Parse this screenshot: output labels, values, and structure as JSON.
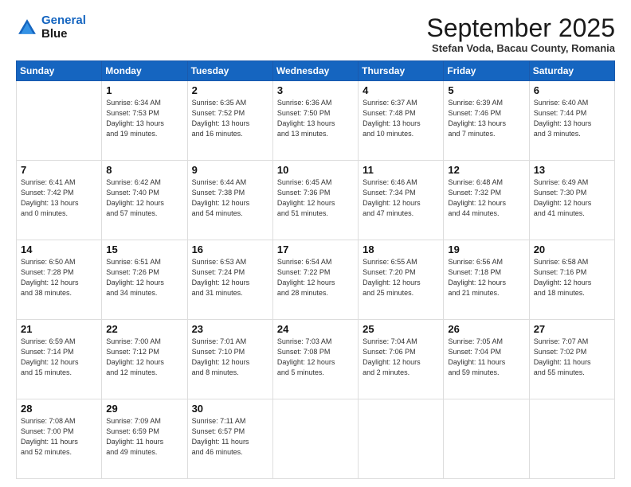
{
  "header": {
    "logo_line1": "General",
    "logo_line2": "Blue",
    "month_title": "September 2025",
    "subtitle": "Stefan Voda, Bacau County, Romania"
  },
  "weekdays": [
    "Sunday",
    "Monday",
    "Tuesday",
    "Wednesday",
    "Thursday",
    "Friday",
    "Saturday"
  ],
  "weeks": [
    [
      {
        "day": "",
        "info": ""
      },
      {
        "day": "1",
        "info": "Sunrise: 6:34 AM\nSunset: 7:53 PM\nDaylight: 13 hours\nand 19 minutes."
      },
      {
        "day": "2",
        "info": "Sunrise: 6:35 AM\nSunset: 7:52 PM\nDaylight: 13 hours\nand 16 minutes."
      },
      {
        "day": "3",
        "info": "Sunrise: 6:36 AM\nSunset: 7:50 PM\nDaylight: 13 hours\nand 13 minutes."
      },
      {
        "day": "4",
        "info": "Sunrise: 6:37 AM\nSunset: 7:48 PM\nDaylight: 13 hours\nand 10 minutes."
      },
      {
        "day": "5",
        "info": "Sunrise: 6:39 AM\nSunset: 7:46 PM\nDaylight: 13 hours\nand 7 minutes."
      },
      {
        "day": "6",
        "info": "Sunrise: 6:40 AM\nSunset: 7:44 PM\nDaylight: 13 hours\nand 3 minutes."
      }
    ],
    [
      {
        "day": "7",
        "info": "Sunrise: 6:41 AM\nSunset: 7:42 PM\nDaylight: 13 hours\nand 0 minutes."
      },
      {
        "day": "8",
        "info": "Sunrise: 6:42 AM\nSunset: 7:40 PM\nDaylight: 12 hours\nand 57 minutes."
      },
      {
        "day": "9",
        "info": "Sunrise: 6:44 AM\nSunset: 7:38 PM\nDaylight: 12 hours\nand 54 minutes."
      },
      {
        "day": "10",
        "info": "Sunrise: 6:45 AM\nSunset: 7:36 PM\nDaylight: 12 hours\nand 51 minutes."
      },
      {
        "day": "11",
        "info": "Sunrise: 6:46 AM\nSunset: 7:34 PM\nDaylight: 12 hours\nand 47 minutes."
      },
      {
        "day": "12",
        "info": "Sunrise: 6:48 AM\nSunset: 7:32 PM\nDaylight: 12 hours\nand 44 minutes."
      },
      {
        "day": "13",
        "info": "Sunrise: 6:49 AM\nSunset: 7:30 PM\nDaylight: 12 hours\nand 41 minutes."
      }
    ],
    [
      {
        "day": "14",
        "info": "Sunrise: 6:50 AM\nSunset: 7:28 PM\nDaylight: 12 hours\nand 38 minutes."
      },
      {
        "day": "15",
        "info": "Sunrise: 6:51 AM\nSunset: 7:26 PM\nDaylight: 12 hours\nand 34 minutes."
      },
      {
        "day": "16",
        "info": "Sunrise: 6:53 AM\nSunset: 7:24 PM\nDaylight: 12 hours\nand 31 minutes."
      },
      {
        "day": "17",
        "info": "Sunrise: 6:54 AM\nSunset: 7:22 PM\nDaylight: 12 hours\nand 28 minutes."
      },
      {
        "day": "18",
        "info": "Sunrise: 6:55 AM\nSunset: 7:20 PM\nDaylight: 12 hours\nand 25 minutes."
      },
      {
        "day": "19",
        "info": "Sunrise: 6:56 AM\nSunset: 7:18 PM\nDaylight: 12 hours\nand 21 minutes."
      },
      {
        "day": "20",
        "info": "Sunrise: 6:58 AM\nSunset: 7:16 PM\nDaylight: 12 hours\nand 18 minutes."
      }
    ],
    [
      {
        "day": "21",
        "info": "Sunrise: 6:59 AM\nSunset: 7:14 PM\nDaylight: 12 hours\nand 15 minutes."
      },
      {
        "day": "22",
        "info": "Sunrise: 7:00 AM\nSunset: 7:12 PM\nDaylight: 12 hours\nand 12 minutes."
      },
      {
        "day": "23",
        "info": "Sunrise: 7:01 AM\nSunset: 7:10 PM\nDaylight: 12 hours\nand 8 minutes."
      },
      {
        "day": "24",
        "info": "Sunrise: 7:03 AM\nSunset: 7:08 PM\nDaylight: 12 hours\nand 5 minutes."
      },
      {
        "day": "25",
        "info": "Sunrise: 7:04 AM\nSunset: 7:06 PM\nDaylight: 12 hours\nand 2 minutes."
      },
      {
        "day": "26",
        "info": "Sunrise: 7:05 AM\nSunset: 7:04 PM\nDaylight: 11 hours\nand 59 minutes."
      },
      {
        "day": "27",
        "info": "Sunrise: 7:07 AM\nSunset: 7:02 PM\nDaylight: 11 hours\nand 55 minutes."
      }
    ],
    [
      {
        "day": "28",
        "info": "Sunrise: 7:08 AM\nSunset: 7:00 PM\nDaylight: 11 hours\nand 52 minutes."
      },
      {
        "day": "29",
        "info": "Sunrise: 7:09 AM\nSunset: 6:59 PM\nDaylight: 11 hours\nand 49 minutes."
      },
      {
        "day": "30",
        "info": "Sunrise: 7:11 AM\nSunset: 6:57 PM\nDaylight: 11 hours\nand 46 minutes."
      },
      {
        "day": "",
        "info": ""
      },
      {
        "day": "",
        "info": ""
      },
      {
        "day": "",
        "info": ""
      },
      {
        "day": "",
        "info": ""
      }
    ]
  ]
}
